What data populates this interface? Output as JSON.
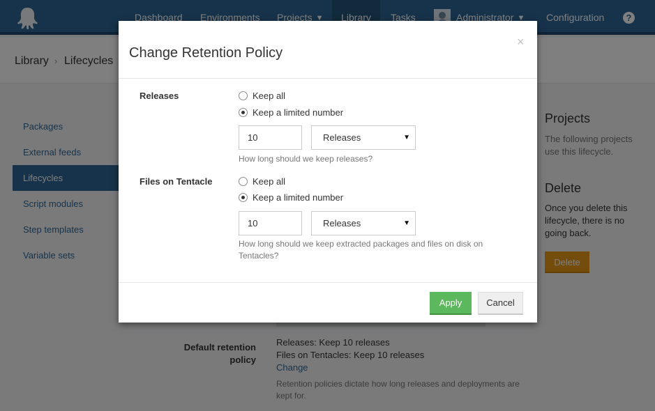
{
  "nav": {
    "items": [
      "Dashboard",
      "Environments",
      "Projects",
      "Library",
      "Tasks",
      "Administrator",
      "Configuration"
    ],
    "help_glyph": "?"
  },
  "breadcrumb": [
    "Library",
    "Lifecycles"
  ],
  "sidebar": {
    "items": [
      "Packages",
      "External feeds",
      "Lifecycles",
      "Script modules",
      "Step templates",
      "Variable sets"
    ],
    "active": "Lifecycles"
  },
  "right_panel": {
    "projects_heading": "Projects",
    "projects_text": "The following projects use this lifecycle.",
    "delete_heading": "Delete",
    "delete_text": "Once you delete this lifecycle, there is no going back.",
    "delete_button": "Delete",
    "delete_color": "#e99a18"
  },
  "page_bottom": {
    "label": "Default retention policy",
    "releases_line": "Releases: Keep 10 releases",
    "tentacle_line": "Files on Tentacles: Keep 10 releases",
    "change_link": "Change",
    "help": "Retention policies dictate how long releases and deployments are kept for."
  },
  "modal": {
    "title": "Change Retention Policy",
    "close_glyph": "×",
    "releases": {
      "label": "Releases",
      "option_keep_all": "Keep all",
      "option_limited": "Keep a limited number",
      "selected": "Keep a limited number",
      "quantity": "10",
      "unit": "Releases",
      "help": "How long should we keep releases?"
    },
    "tentacle": {
      "label": "Files on Tentacle",
      "option_keep_all": "Keep all",
      "option_limited": "Keep a limited number",
      "selected": "Keep a limited number",
      "quantity": "10",
      "unit": "Releases",
      "help": "How long should we keep extracted packages and files on disk on Tentacles?"
    },
    "apply_button": "Apply",
    "cancel_button": "Cancel"
  },
  "colors": {
    "nav_bg": "#2f6796",
    "apply": "#5cb85c",
    "overlay": "rgba(0,0,0,0.5)"
  }
}
